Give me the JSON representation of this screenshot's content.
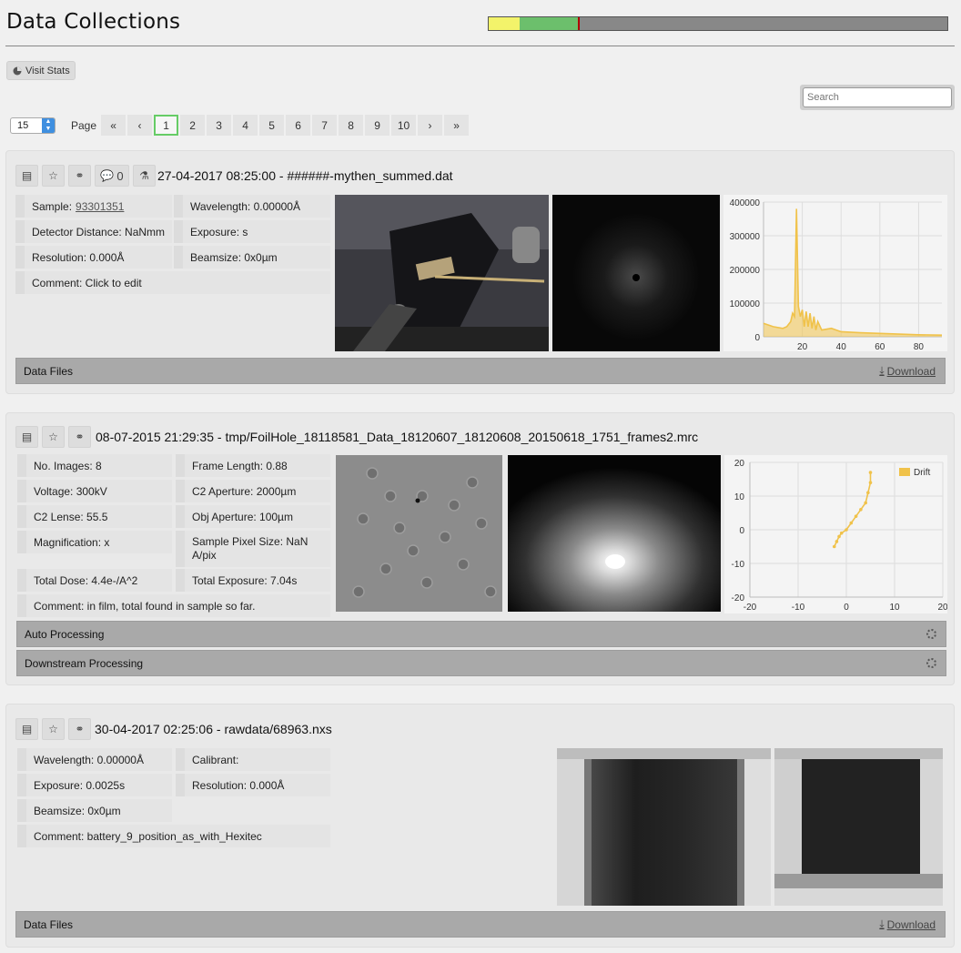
{
  "header": {
    "title": "Data Collections",
    "progress_colors": [
      "#f3f36a",
      "#6cbf6c",
      "#b00000",
      "#888888"
    ]
  },
  "toolbar": {
    "visit_stats_label": "Visit Stats",
    "search_placeholder": "Search",
    "per_page": "15"
  },
  "pagination": {
    "label": "Page",
    "first": "«",
    "prev": "‹",
    "next": "›",
    "last": "»",
    "pages": [
      "1",
      "2",
      "3",
      "4",
      "5",
      "6",
      "7",
      "8",
      "9",
      "10"
    ],
    "active": "1"
  },
  "collections": [
    {
      "title": "27-04-2017 08:25:00 - ######-mythen_summed.dat",
      "comments_count": "0",
      "fields": {
        "sample_label": "Sample:",
        "sample_value": "93301351",
        "wavelength": "Wavelength: 0.00000Å",
        "detector_distance": "Detector Distance: NaNmm",
        "exposure": "Exposure: s",
        "resolution": "Resolution: 0.000Å",
        "beamsize": "Beamsize: 0x0µm",
        "comment": "Comment:  Click to edit"
      },
      "chart_data": {
        "type": "line",
        "x_ticks": [
          "20",
          "40",
          "60",
          "80"
        ],
        "y_ticks": [
          "400000",
          "300000",
          "200000",
          "100000",
          "0"
        ],
        "xlim": [
          0,
          92
        ],
        "ylim": [
          0,
          400000
        ],
        "series": [
          {
            "color": "#f0c24a",
            "x": [
              0,
              5,
              10,
              12,
              14,
              15,
              16,
              17,
              18,
              19,
              20,
              21,
              22,
              23,
              24,
              25,
              26,
              27,
              28,
              30,
              35,
              40,
              50,
              60,
              70,
              80,
              92
            ],
            "y": [
              40000,
              30000,
              25000,
              30000,
              45000,
              70000,
              60000,
              380000,
              90000,
              60000,
              80000,
              30000,
              75000,
              30000,
              70000,
              25000,
              60000,
              20000,
              45000,
              20000,
              25000,
              15000,
              12000,
              10000,
              8000,
              6000,
              5000
            ]
          }
        ]
      },
      "footer_label": "Data Files",
      "download_label": "Download"
    },
    {
      "title": "08-07-2015 21:29:35 - tmp/FoilHole_18118581_Data_18120607_18120608_20150618_1751_frames2.mrc",
      "fields": {
        "no_images": "No. Images: 8",
        "frame_length": "Frame Length: 0.88",
        "voltage": "Voltage: 300kV",
        "c2_aperture": "C2 Aperture: 2000µm",
        "c2_lense": "C2 Lense: 55.5",
        "obj_aperture": "Obj Aperture: 100µm",
        "magnification": "Magnification: x",
        "pixel_size": "Sample Pixel Size: NaN A/pix",
        "total_dose": "Total Dose: 4.4e-/A^2",
        "total_exposure": "Total Exposure: 7.04s",
        "comment": "Comment:  in film, total found in sample so far."
      },
      "chart_data": {
        "type": "line",
        "x_ticks": [
          "-20",
          "-10",
          "0",
          "10",
          "20"
        ],
        "y_ticks": [
          "20",
          "10",
          "0",
          "-10",
          "-20"
        ],
        "xlim": [
          -20,
          20
        ],
        "ylim": [
          -20,
          20
        ],
        "legend": "Drift",
        "legend_color": "#f0c24a",
        "series": [
          {
            "name": "Drift",
            "color": "#f0c24a",
            "x": [
              -2.5,
              -2,
              -1.5,
              -1,
              0,
              1,
              2,
              3,
              4,
              4.5,
              5,
              5
            ],
            "y": [
              -5,
              -3.5,
              -2,
              -1,
              0,
              2,
              4,
              6,
              8,
              11,
              14,
              17
            ]
          }
        ]
      },
      "bars": [
        "Auto Processing",
        "Downstream Processing"
      ]
    },
    {
      "title": "30-04-2017 02:25:06 - rawdata/68963.nxs",
      "fields": {
        "wavelength": "Wavelength: 0.00000Å",
        "calibrant": "Calibrant:",
        "exposure": "Exposure: 0.0025s",
        "resolution": "Resolution: 0.000Å",
        "beamsize": "Beamsize: 0x0µm",
        "comment": "Comment:  battery_9_position_as_with_Hexitec"
      },
      "footer_label": "Data Files",
      "download_label": "Download"
    }
  ]
}
